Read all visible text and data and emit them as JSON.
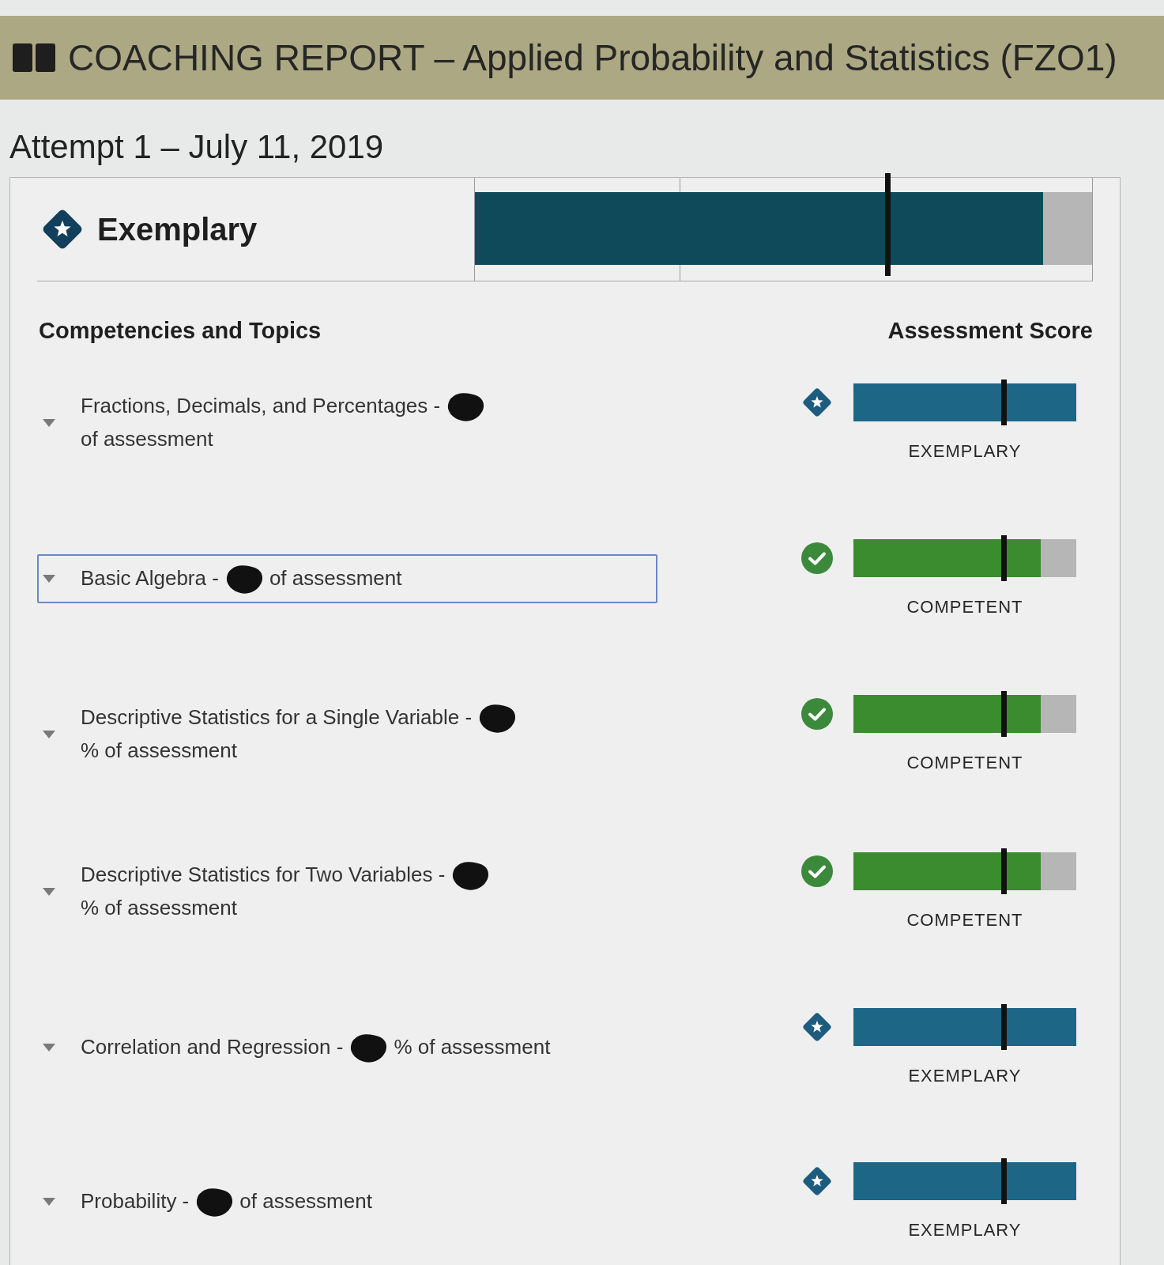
{
  "header": {
    "title": "COACHING REPORT – Applied Probability and Statistics (FZO1)"
  },
  "attempt": "Attempt 1 – July 11, 2019",
  "overall": {
    "kind": "exemplary",
    "label": "Exemplary",
    "level": 0.92
  },
  "columns": {
    "topics": "Competencies and Topics",
    "score": "Assessment Score"
  },
  "topics": [
    {
      "kind": "exemplary",
      "topic": "Fractions, Decimals, and Percentages -",
      "redacted": true,
      "share": "of assessment",
      "focused": false,
      "level": 1,
      "rating": "EXEMPLARY"
    },
    {
      "kind": "competent",
      "topic": "Basic Algebra -",
      "redacted": true,
      "share": "of assessment",
      "focused": true,
      "level": 0.84,
      "rating": "COMPETENT"
    },
    {
      "kind": "competent",
      "topic": "Descriptive Statistics for a Single Variable -",
      "redacted": true,
      "share": "% of assessment",
      "focused": false,
      "level": 0.84,
      "rating": "COMPETENT"
    },
    {
      "kind": "competent",
      "topic": "Descriptive Statistics for Two Variables -",
      "redacted": true,
      "share": "% of assessment",
      "focused": false,
      "level": 0.84,
      "rating": "COMPETENT"
    },
    {
      "kind": "exemplary",
      "topic": "Correlation and Regression -",
      "redacted": true,
      "share": "% of assessment",
      "focused": false,
      "level": 1,
      "rating": "EXEMPLARY"
    },
    {
      "kind": "exemplary",
      "topic": "Probability -",
      "redacted": true,
      "share": "of assessment",
      "focused": false,
      "level": 1,
      "rating": "EXEMPLARY"
    }
  ]
}
